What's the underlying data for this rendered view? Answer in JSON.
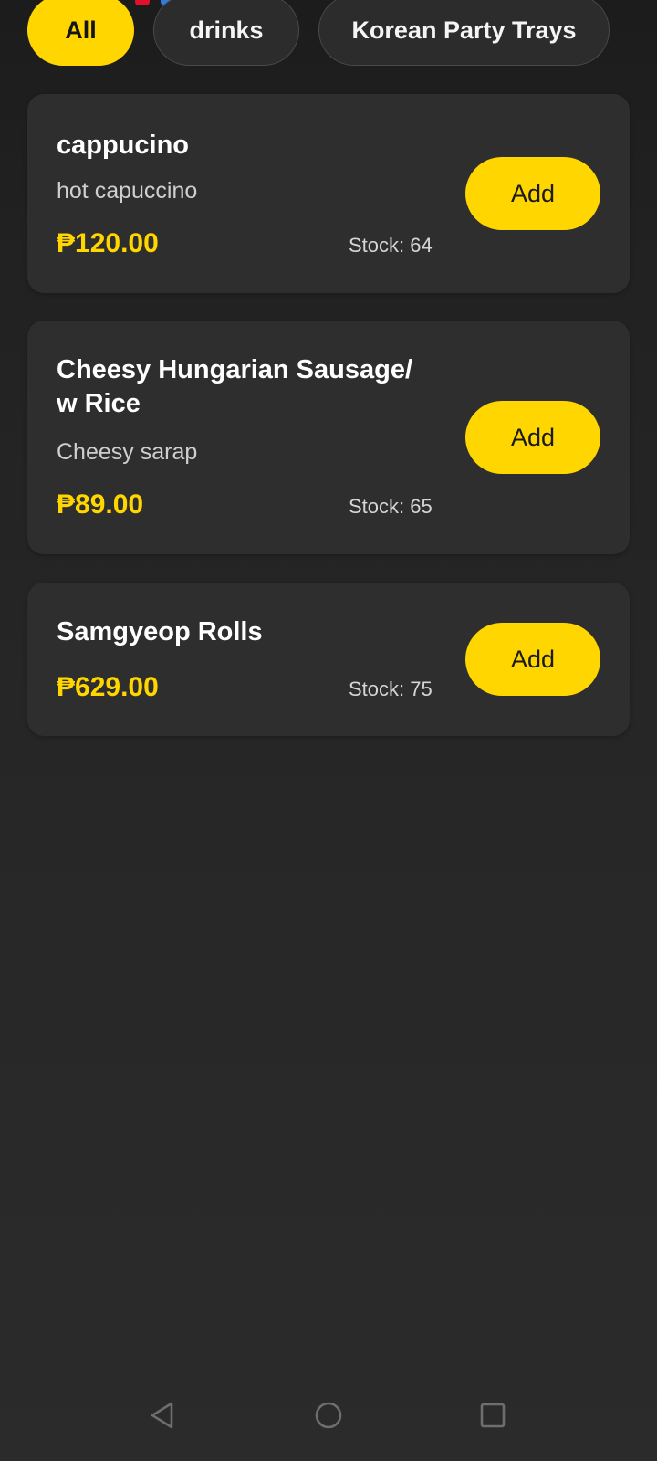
{
  "categories": [
    {
      "label": "All",
      "active": true
    },
    {
      "label": "drinks",
      "active": false
    },
    {
      "label": "Korean Party Trays",
      "active": false
    }
  ],
  "products": [
    {
      "name": "cappucino",
      "description": "hot capuccino",
      "price": "₱120.00",
      "stock": "Stock: 64",
      "add_label": "Add"
    },
    {
      "name": "Cheesy Hungarian Sausage/ w Rice",
      "description": "Cheesy sarap",
      "price": "₱89.00",
      "stock": "Stock: 65",
      "add_label": "Add"
    },
    {
      "name": "Samgyeop Rolls",
      "description": "",
      "price": "₱629.00",
      "stock": "Stock: 75",
      "add_label": "Add"
    }
  ],
  "navbar": {
    "icons": [
      "back-triangle-icon",
      "home-circle-icon",
      "recents-square-icon"
    ]
  },
  "colors": {
    "accent": "#ffd600",
    "card": "#2e2e2e",
    "background": "#222222"
  }
}
